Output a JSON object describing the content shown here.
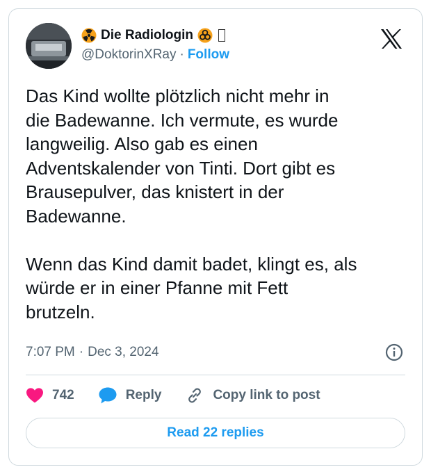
{
  "tweet": {
    "display_name": "Die Radiologin",
    "handle": "@DoktorinXRay",
    "separator": "·",
    "follow_label": "Follow",
    "text": "Das Kind wollte plötzlich nicht mehr in\ndie Badewanne. Ich vermute, es wurde\nlangweilig. Also gab es einen\nAdventskalender von Tinti. Dort gibt es\nBrausepulver, das knistert in der\nBadewanne.\n\nWenn das Kind damit badet, klingt es, als\nwürde er in einer Pfanne mit Fett\nbrutzeln.",
    "time": "7:07 PM",
    "date": "Dec 3, 2024"
  },
  "actions": {
    "like_count": "742",
    "reply_label": "Reply",
    "copy_link_label": "Copy link to post"
  },
  "read_replies_label": "Read 22 replies",
  "colors": {
    "accent": "#1d9bf0",
    "heart": "#f91880",
    "hazard": "#f7a21b",
    "border": "#cfd9de",
    "muted": "#536471"
  },
  "icons": [
    "radioactive-icon",
    "biohazard-icon",
    "x-logo-icon",
    "info-icon",
    "heart-icon",
    "reply-bubble-icon",
    "link-icon"
  ]
}
